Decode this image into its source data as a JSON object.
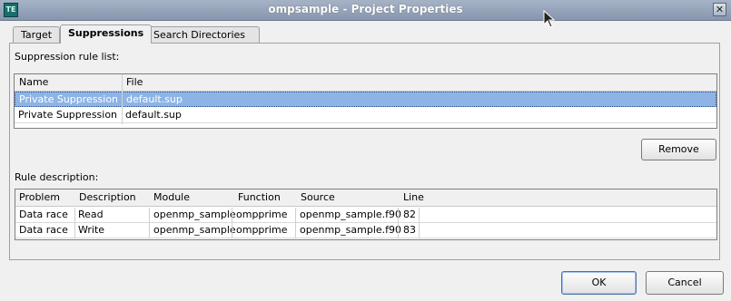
{
  "window": {
    "title": "ompsample - Project Properties",
    "icon_text": "TE"
  },
  "tabs": [
    {
      "label": "Target"
    },
    {
      "label": "Suppressions"
    },
    {
      "label": "Search Directories"
    }
  ],
  "suppression": {
    "heading": "Suppression rule list:",
    "columns": [
      "Name",
      "File"
    ],
    "rows": [
      {
        "name": "Private Suppression",
        "file": "default.sup",
        "selected": true
      },
      {
        "name": "Private Suppression",
        "file": "default.sup",
        "selected": false
      }
    ],
    "remove_label": "Remove"
  },
  "rule": {
    "heading": "Rule description:",
    "columns": [
      "Problem",
      "Description",
      "Module",
      "Function",
      "Source",
      "Line"
    ],
    "rows": [
      {
        "problem": "Data race",
        "description": "Read",
        "module": "openmp_sample",
        "function": "ompprime",
        "source": "openmp_sample.f90",
        "line": "82"
      },
      {
        "problem": "Data race",
        "description": "Write",
        "module": "openmp_sample",
        "function": "ompprime",
        "source": "openmp_sample.f90",
        "line": "83"
      }
    ]
  },
  "footer": {
    "ok_label": "OK",
    "cancel_label": "Cancel"
  },
  "icons": {
    "app": "app-icon",
    "close": "close-icon",
    "cursor": "mouse-cursor-icon"
  }
}
